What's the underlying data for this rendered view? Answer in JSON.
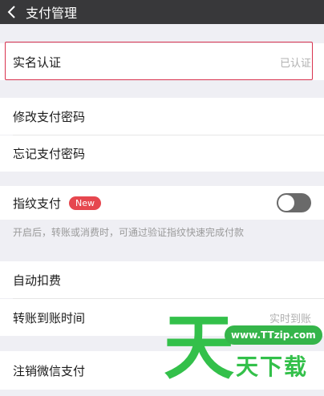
{
  "header": {
    "title": "支付管理",
    "back_icon": "chevron-left-icon"
  },
  "verification": {
    "label": "实名认证",
    "status": "已认证"
  },
  "password": {
    "change_label": "修改支付密码",
    "forgot_label": "忘记支付密码"
  },
  "fingerprint": {
    "label": "指纹支付",
    "badge": "New",
    "enabled": false,
    "hint": "开启后，转账或消费时，可通过验证指纹快速完成付款"
  },
  "auto_deduction": {
    "label": "自动扣费"
  },
  "transfer": {
    "label": "转账到账时间",
    "value": "实时到账"
  },
  "deregister": {
    "label": "注销微信支付"
  },
  "watermark": {
    "big": "天",
    "url": "www.TTzip.com",
    "small": "天下载"
  },
  "colors": {
    "highlight": "#d9334f",
    "badge": "#e6474f",
    "titlebar": "#38383a",
    "watermark": "#33c04a"
  }
}
